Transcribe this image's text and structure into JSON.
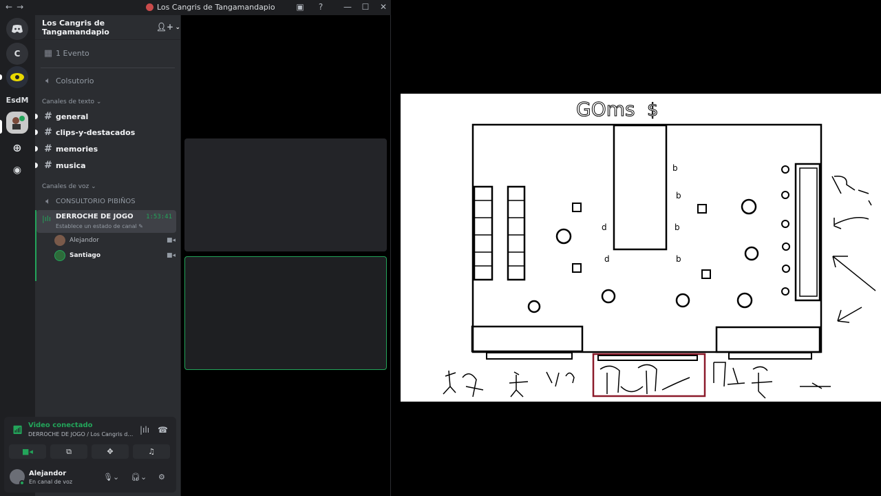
{
  "window": {
    "title": "Los Cangris de Tangamandapio",
    "nav_back": "←",
    "nav_forward": "→",
    "controls": {
      "minimize": "—",
      "maximize": "☐",
      "close": "✕"
    }
  },
  "rail": {
    "servers": [
      {
        "label": "C"
      },
      {
        "label": "EsdM"
      }
    ]
  },
  "server": {
    "name": "Los Cangris de Tangamandapio",
    "events": "1 Evento",
    "voice_top": "Colsutorio",
    "text_category": "Canales de texto",
    "text_channels": [
      "general",
      "clips-y-destacados",
      "memories",
      "musica"
    ],
    "voice_category": "Canales de voz",
    "voice_channels": {
      "inactive": "CONSULTORIO PIBIÑOS",
      "active": {
        "name": "DERROCHE DE JOGO",
        "status": "Establece un estado de canal",
        "timer": "1:53:41"
      }
    },
    "members": [
      "Alejandor",
      "Santiago"
    ]
  },
  "voice_panel": {
    "status": "Video conectado",
    "subtitle": "DERROCHE DE JOGO / Los Cangris de T..."
  },
  "user": {
    "name": "Alejandor",
    "status": "En canal de voz"
  },
  "drawing": {
    "header_text": "GOms"
  },
  "colors": {
    "accent_green": "#23a55a",
    "background": "#1e1f22",
    "sidebar": "#2b2d31",
    "highlight_box": "#8b1a2a"
  }
}
